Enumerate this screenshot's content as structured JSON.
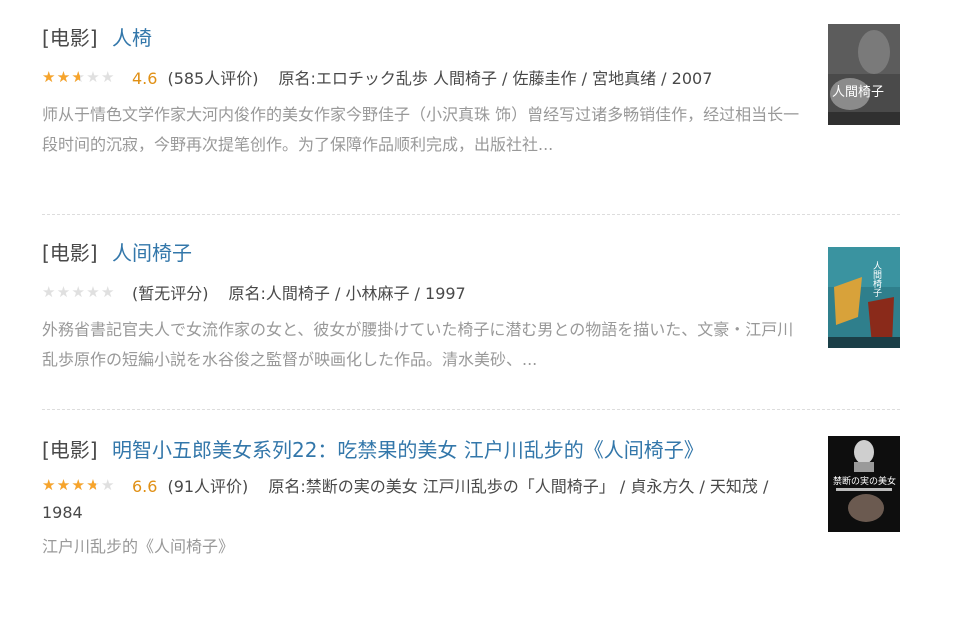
{
  "results": [
    {
      "category": "[电影]",
      "title": "人椅",
      "score": "4.6",
      "stars_fraction": 0.46,
      "rating_count": "(585人评价)",
      "meta": "原名:エロチック乱歩 人間椅子 / 佐藤圭作 / 宮地真绪 / 2007",
      "description": "师从于情色文学作家大河内俊作的美女作家今野佳子（小沢真珠 饰）曾经写过诸多畅销佳作，经过相当长一段时间的沉寂，今野再次提笔创作。为了保障作品顺利完成，出版社社...",
      "poster_text": "人間椅子"
    },
    {
      "category": "[电影]",
      "title": "人间椅子",
      "score": "",
      "stars_fraction": 0,
      "rating_count": "(暂无评分)",
      "meta": "原名:人間椅子 / 小林麻子 / 1997",
      "description": "外務省書記官夫人で女流作家の女と、彼女が腰掛けていた椅子に潜む男との物語を描いた、文豪・江戸川乱歩原作の短編小説を水谷俊之監督が映画化した作品。清水美砂、...",
      "poster_text": "人間椅子"
    },
    {
      "category": "[电影]",
      "title": "明智小五郎美女系列22：吃禁果的美女 江户川乱步的《人间椅子》",
      "score": "6.6",
      "stars_fraction": 0.66,
      "rating_count": "(91人评价)",
      "meta": "原名:禁断の実の美女 江戸川乱歩の「人間椅子」 / 貞永方久 / 天知茂 / 1984",
      "description": "江户川乱步的《人间椅子》",
      "poster_text": "禁断の実の美女"
    }
  ],
  "colors": {
    "link": "#3377aa",
    "star": "#f7a42b",
    "score": "#e09015",
    "muted": "#999999"
  },
  "icons": [
    "star-rating-icon",
    "movie-poster-thumbnail"
  ]
}
